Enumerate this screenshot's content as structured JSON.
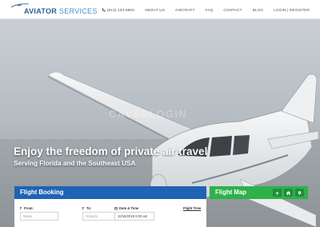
{
  "header": {
    "logo_primary": "AVIATOR",
    "logo_secondary": " SERVICES",
    "nav": {
      "phone": "(813) 234-8800",
      "about": "ABOUT US",
      "aircraft": "AIRCRAFT",
      "faq": "FAQ",
      "contact": "CONTACT",
      "blog": "BLOG",
      "login": "LOGIN | REGISTER"
    }
  },
  "hero": {
    "watermark": "CAVERLOGIN",
    "title": "Enjoy the freedom of private air travel",
    "subtitle": "Serving Florida and the Southeast USA"
  },
  "booking": {
    "title": "Flight Booking",
    "from_label": "From:",
    "from_placeholder": "Miami",
    "to_label": "To:",
    "to_placeholder": "Orlando",
    "datetime_label": "Date & Time",
    "datetime_value": "10/18/2018 9:00 am",
    "flight_time_link": "Flight Time"
  },
  "map": {
    "title": "Flight Map"
  },
  "colors": {
    "booking_header": "#1f63b5",
    "map_header": "#2db24a",
    "logo_dark": "#2b5f93",
    "logo_light": "#4a8fc9"
  },
  "icons": {
    "phone": "phone-icon",
    "from": "flag-icon",
    "to": "flag-icon",
    "datetime": "calendar-icon",
    "map_buttons": [
      "plane-icon",
      "building-icon",
      "location-pin-icon"
    ]
  }
}
